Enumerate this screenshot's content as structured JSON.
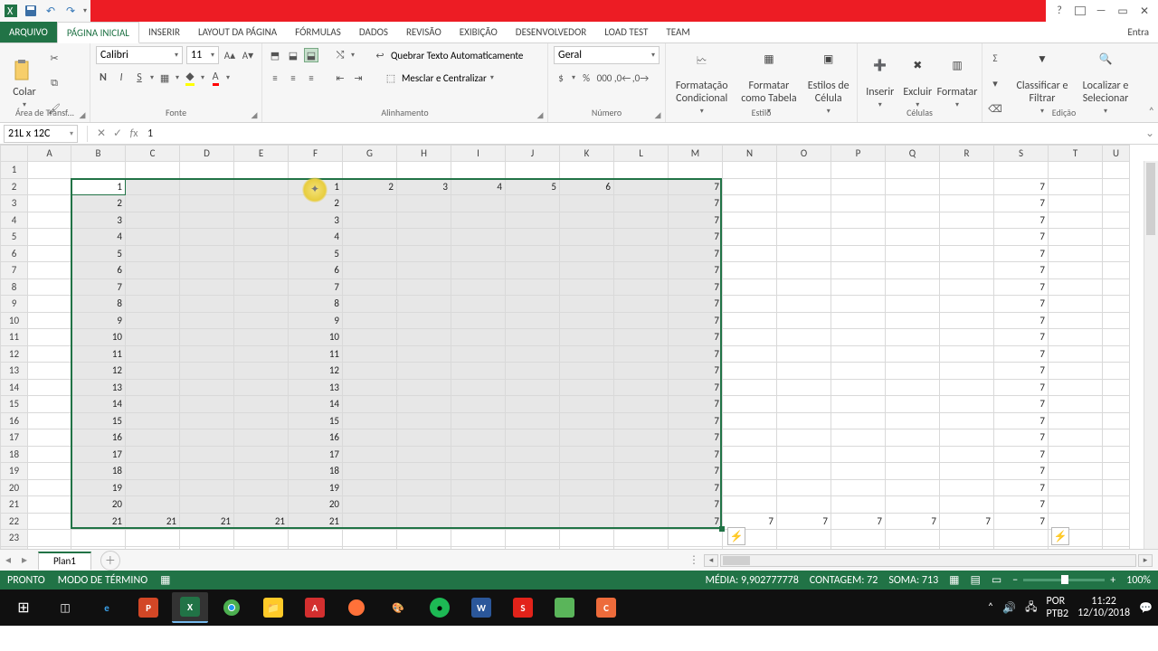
{
  "tabs": {
    "file": "ARQUIVO",
    "items": [
      "PÁGINA INICIAL",
      "INSERIR",
      "LAYOUT DA PÁGINA",
      "FÓRMULAS",
      "DADOS",
      "REVISÃO",
      "EXIBIÇÃO",
      "DESENVOLVEDOR",
      "LOAD TEST",
      "TEAM"
    ],
    "active": 0,
    "signin": "Entra"
  },
  "ribbon": {
    "clipboard": {
      "label": "Área de Transf...",
      "paste": "Colar"
    },
    "font": {
      "label": "Fonte",
      "name": "Calibri",
      "size": "11"
    },
    "alignment": {
      "label": "Alinhamento",
      "wrap": "Quebrar Texto Automaticamente",
      "merge": "Mesclar e Centralizar"
    },
    "number": {
      "label": "Número",
      "format": "Geral"
    },
    "styles": {
      "label": "Estilo",
      "cond": "Formatação Condicional",
      "table": "Formatar como Tabela",
      "cell": "Estilos de Célula"
    },
    "cells": {
      "label": "Células",
      "insert": "Inserir",
      "delete": "Excluir",
      "format": "Formatar"
    },
    "editing": {
      "label": "Edição",
      "sort": "Classificar e Filtrar",
      "find": "Localizar e Selecionar"
    }
  },
  "fx": {
    "name": "21L x 12C",
    "value": "1"
  },
  "columns": [
    "A",
    "B",
    "C",
    "D",
    "E",
    "F",
    "G",
    "H",
    "I",
    "J",
    "K",
    "L",
    "M",
    "N",
    "O",
    "P",
    "Q",
    "R",
    "S",
    "T",
    "U"
  ],
  "rows": 24,
  "selection": {
    "r1": 2,
    "c1": 2,
    "r2": 22,
    "c2": 13
  },
  "cursor": {
    "row": 2,
    "colIndex": 5
  },
  "cells": {
    "2": {
      "B": "1",
      "F": "1",
      "G": "2",
      "H": "3",
      "I": "4",
      "J": "5",
      "K": "6",
      "M": "7",
      "S": "7"
    },
    "3": {
      "B": "2",
      "F": "2",
      "M": "7",
      "S": "7"
    },
    "4": {
      "B": "3",
      "F": "3",
      "M": "7",
      "S": "7"
    },
    "5": {
      "B": "4",
      "F": "4",
      "M": "7",
      "S": "7"
    },
    "6": {
      "B": "5",
      "F": "5",
      "M": "7",
      "S": "7"
    },
    "7": {
      "B": "6",
      "F": "6",
      "M": "7",
      "S": "7"
    },
    "8": {
      "B": "7",
      "F": "7",
      "M": "7",
      "S": "7"
    },
    "9": {
      "B": "8",
      "F": "8",
      "M": "7",
      "S": "7"
    },
    "10": {
      "B": "9",
      "F": "9",
      "M": "7",
      "S": "7"
    },
    "11": {
      "B": "10",
      "F": "10",
      "M": "7",
      "S": "7"
    },
    "12": {
      "B": "11",
      "F": "11",
      "M": "7",
      "S": "7"
    },
    "13": {
      "B": "12",
      "F": "12",
      "M": "7",
      "S": "7"
    },
    "14": {
      "B": "13",
      "F": "13",
      "M": "7",
      "S": "7"
    },
    "15": {
      "B": "14",
      "F": "14",
      "M": "7",
      "S": "7"
    },
    "16": {
      "B": "15",
      "F": "15",
      "M": "7",
      "S": "7"
    },
    "17": {
      "B": "16",
      "F": "16",
      "M": "7",
      "S": "7"
    },
    "18": {
      "B": "17",
      "F": "17",
      "M": "7",
      "S": "7"
    },
    "19": {
      "B": "18",
      "F": "18",
      "M": "7",
      "S": "7"
    },
    "20": {
      "B": "19",
      "F": "19",
      "M": "7",
      "S": "7"
    },
    "21": {
      "B": "20",
      "F": "20",
      "M": "7",
      "S": "7"
    },
    "22": {
      "B": "21",
      "C": "21",
      "D": "21",
      "E": "21",
      "F": "21",
      "M": "7",
      "N": "7",
      "O": "7",
      "P": "7",
      "Q": "7",
      "R": "7",
      "S": "7"
    }
  },
  "dashedCols": [
    "J",
    "T"
  ],
  "sheetTabs": {
    "active": "Plan1"
  },
  "status": {
    "ready": "PRONTO",
    "mode": "MODO DE TÉRMINO",
    "avg": "MÉDIA: 9,902777778",
    "count": "CONTAGEM: 72",
    "sum": "SOMA: 713",
    "zoom": "100%"
  },
  "clock": {
    "time": "11:22",
    "date": "12/10/2018"
  },
  "colWidths": {
    "default": 60,
    "A": 48,
    "U": 30
  }
}
